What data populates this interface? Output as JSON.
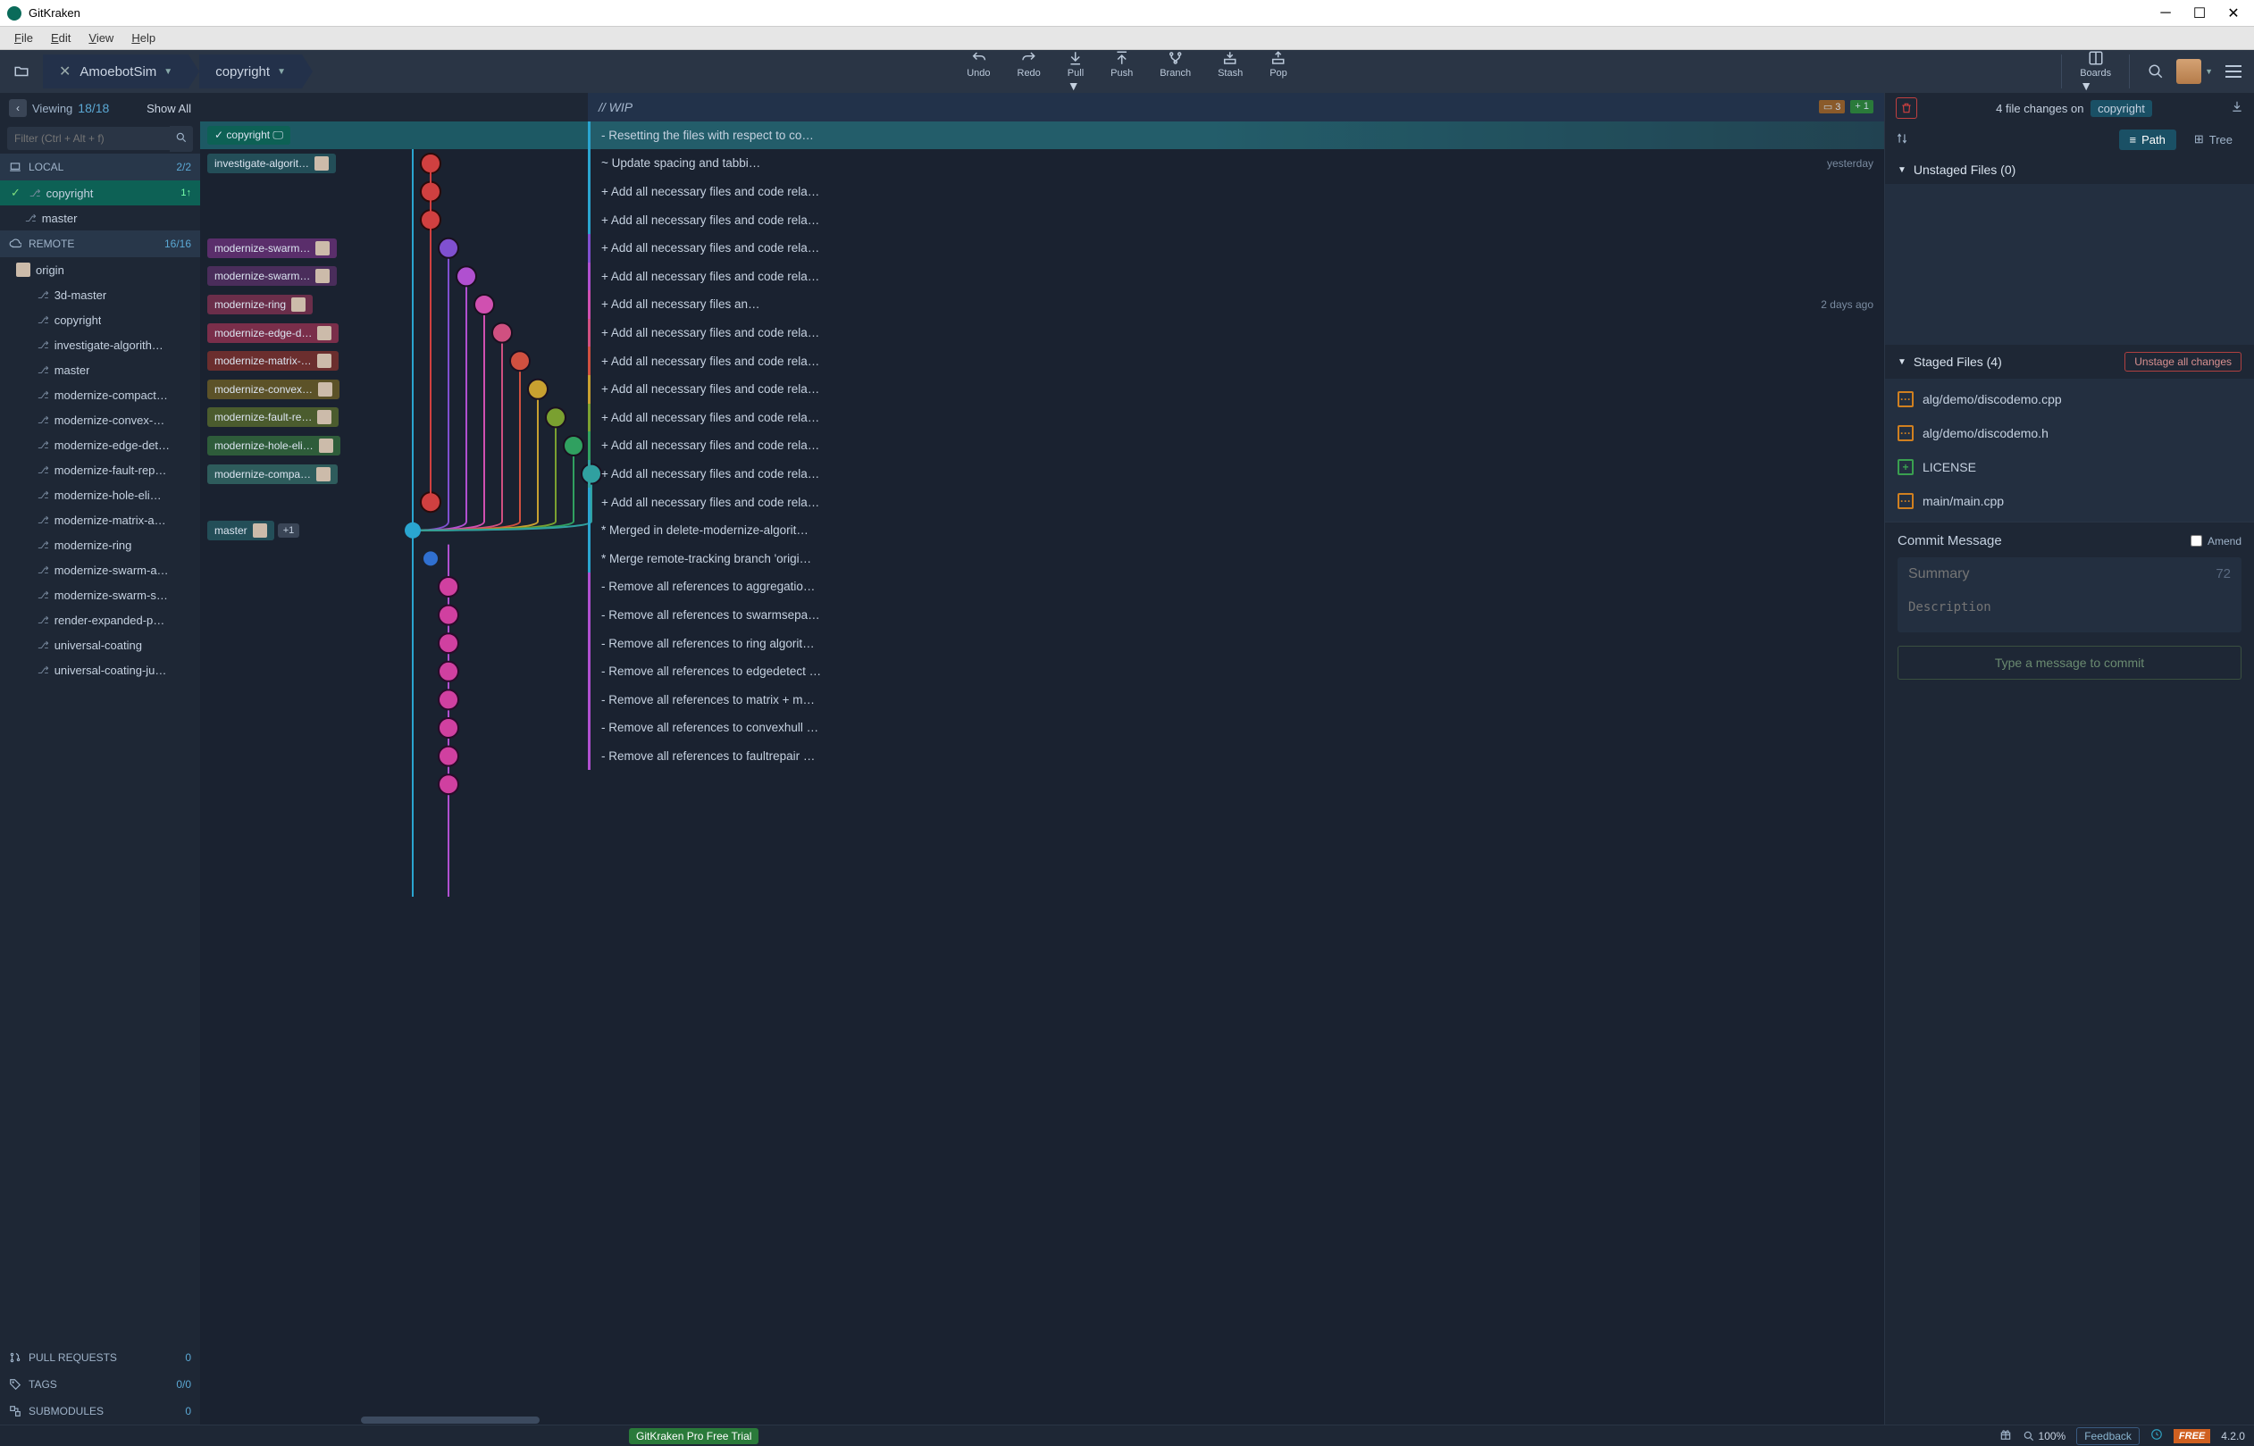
{
  "app": {
    "title": "GitKraken"
  },
  "menubar": [
    "File",
    "Edit",
    "View",
    "Help"
  ],
  "breadcrumb": {
    "repo": "AmoebotSim",
    "branch": "copyright"
  },
  "toolbar": {
    "undo": "Undo",
    "redo": "Redo",
    "pull": "Pull",
    "push": "Push",
    "branch": "Branch",
    "stash": "Stash",
    "pop": "Pop",
    "boards": "Boards"
  },
  "sidebar": {
    "viewing_label": "Viewing",
    "viewing_count": "18/18",
    "show_all": "Show All",
    "filter_placeholder": "Filter (Ctrl + Alt + f)",
    "local_label": "LOCAL",
    "local_count": "2/2",
    "local_branches": [
      {
        "name": "copyright",
        "active": true,
        "tail": "1↑"
      },
      {
        "name": "master"
      }
    ],
    "remote_label": "REMOTE",
    "remote_count": "16/16",
    "origin": "origin",
    "remote_branches": [
      "3d-master",
      "copyright",
      "investigate-algorith…",
      "master",
      "modernize-compact…",
      "modernize-convex-…",
      "modernize-edge-det…",
      "modernize-fault-rep…",
      "modernize-hole-eli…",
      "modernize-matrix-a…",
      "modernize-ring",
      "modernize-swarm-a…",
      "modernize-swarm-s…",
      "render-expanded-p…",
      "universal-coating",
      "universal-coating-ju…"
    ],
    "pull_requests": "PULL REQUESTS",
    "pr_count": "0",
    "tags": "TAGS",
    "tags_count": "0/0",
    "submodules": "SUBMODULES",
    "sub_count": "0"
  },
  "graph": {
    "wip_label": "// WIP",
    "wip_mod": "3",
    "wip_add": "1",
    "rows": [
      {
        "labels": [
          {
            "text": "✓ copyright 🖵",
            "cls": "green"
          }
        ],
        "msg": "- Resetting the files with respect to co…",
        "color": "#2aa5d0",
        "sel": true
      },
      {
        "labels": [
          {
            "text": "investigate-algorit…",
            "cls": "teal",
            "av": true
          }
        ],
        "msg": "~ Update spacing and tabbi…",
        "date": "yesterday",
        "color": "#2aa5d0"
      },
      {
        "msg": "+ Add all necessary files and code rela…",
        "color": "#2aa5d0"
      },
      {
        "msg": "+ Add all necessary files and code rela…",
        "color": "#2aa5d0"
      },
      {
        "labels": [
          {
            "text": "modernize-swarm…",
            "cls": "purple",
            "av": true
          }
        ],
        "msg": "+ Add all necessary files and code rela…",
        "color": "#8050d0"
      },
      {
        "labels": [
          {
            "text": "modernize-swarm…",
            "cls": "purp2",
            "av": true
          }
        ],
        "msg": "+ Add all necessary files and code rela…",
        "color": "#b050d0"
      },
      {
        "labels": [
          {
            "text": "modernize-ring",
            "cls": "pink",
            "av": true
          }
        ],
        "msg": "+ Add all necessary files an…",
        "date": "2 days ago",
        "color": "#d050b0"
      },
      {
        "labels": [
          {
            "text": "modernize-edge-d…",
            "cls": "mag",
            "av": true
          }
        ],
        "msg": "+ Add all necessary files and code rela…",
        "color": "#d05080"
      },
      {
        "labels": [
          {
            "text": "modernize-matrix-…",
            "cls": "red",
            "av": true
          }
        ],
        "msg": "+ Add all necessary files and code rela…",
        "color": "#d05040"
      },
      {
        "labels": [
          {
            "text": "modernize-convex…",
            "cls": "gold",
            "av": true
          }
        ],
        "msg": "+ Add all necessary files and code rela…",
        "color": "#c8a030"
      },
      {
        "labels": [
          {
            "text": "modernize-fault-re…",
            "cls": "olive",
            "av": true
          }
        ],
        "msg": "+ Add all necessary files and code rela…",
        "color": "#7aa030"
      },
      {
        "labels": [
          {
            "text": "modernize-hole-eli…",
            "cls": "grn2",
            "av": true
          }
        ],
        "msg": "+ Add all necessary files and code rela…",
        "color": "#30a060"
      },
      {
        "labels": [
          {
            "text": "modernize-compa…",
            "cls": "cy",
            "av": true
          }
        ],
        "msg": "+ Add all necessary files and code rela…",
        "color": "#30a0a0"
      },
      {
        "msg": "+ Add all necessary files and code rela…",
        "color": "#2aa5d0"
      },
      {
        "labels": [
          {
            "text": "master",
            "cls": "teal",
            "av": true
          },
          {
            "text": "+1",
            "cls": "plus"
          }
        ],
        "msg": "* Merged in delete-modernize-algorit…",
        "color": "#2aa5d0"
      },
      {
        "msg": "* Merge remote-tracking branch 'origi…",
        "color": "#2aa5d0"
      },
      {
        "msg": "- Remove all references to aggregatio…",
        "color": "#b050d0"
      },
      {
        "msg": "- Remove all references to swarmsepa…",
        "color": "#b050d0"
      },
      {
        "msg": "- Remove all references to ring algorit…",
        "color": "#b050d0"
      },
      {
        "msg": "- Remove all references to edgedetect …",
        "color": "#b050d0"
      },
      {
        "msg": "- Remove all references to matrix + m…",
        "color": "#b050d0"
      },
      {
        "msg": "- Remove all references to convexhull …",
        "color": "#b050d0"
      },
      {
        "msg": "- Remove all references to faultrepair …",
        "color": "#b050d0"
      }
    ]
  },
  "right": {
    "summary": "4 file changes on",
    "branch": "copyright",
    "path": "Path",
    "tree": "Tree",
    "unstaged": "Unstaged Files (0)",
    "staged": "Staged Files (4)",
    "unstage_btn": "Unstage all changes",
    "files": [
      {
        "icon": "mod",
        "name": "alg/demo/discodemo.cpp"
      },
      {
        "icon": "mod",
        "name": "alg/demo/discodemo.h"
      },
      {
        "icon": "add",
        "name": "LICENSE"
      },
      {
        "icon": "mod",
        "name": "main/main.cpp"
      }
    ],
    "commit_msg": "Commit Message",
    "amend": "Amend",
    "summary_ph": "Summary",
    "char_count": "72",
    "desc_ph": "Description",
    "commit_btn": "Type a message to commit"
  },
  "status": {
    "pill": "GitKraken Pro Free Trial",
    "zoom": "100%",
    "feedback": "Feedback",
    "free": "FREE",
    "version": "4.2.0"
  }
}
